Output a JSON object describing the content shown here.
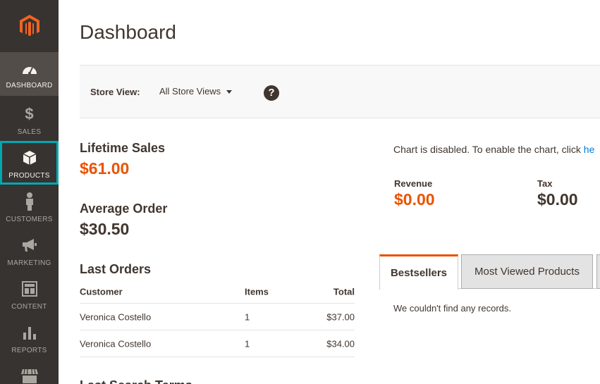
{
  "sidebar": {
    "logo": "magento-logo",
    "items": [
      {
        "label": "DASHBOARD",
        "icon": "gauge-icon",
        "state": "active"
      },
      {
        "label": "SALES",
        "icon": "dollar-icon",
        "state": "normal"
      },
      {
        "label": "PRODUCTS",
        "icon": "box-icon",
        "state": "focused"
      },
      {
        "label": "CUSTOMERS",
        "icon": "person-icon",
        "state": "normal"
      },
      {
        "label": "MARKETING",
        "icon": "megaphone-icon",
        "state": "normal"
      },
      {
        "label": "CONTENT",
        "icon": "layout-icon",
        "state": "normal"
      },
      {
        "label": "REPORTS",
        "icon": "bar-chart-icon",
        "state": "normal"
      },
      {
        "label": "",
        "icon": "store-icon",
        "state": "normal"
      }
    ]
  },
  "header": {
    "title": "Dashboard"
  },
  "store_switcher": {
    "label": "Store View:",
    "value": "All Store Views",
    "help": "?"
  },
  "lifetime_sales": {
    "title": "Lifetime Sales",
    "value": "$61.00"
  },
  "average_order": {
    "title": "Average Order",
    "value": "$30.50"
  },
  "last_orders": {
    "title": "Last Orders",
    "columns": [
      "Customer",
      "Items",
      "Total"
    ],
    "rows": [
      [
        "Veronica Costello",
        "1",
        "$37.00"
      ],
      [
        "Veronica Costello",
        "1",
        "$34.00"
      ]
    ]
  },
  "next_section": {
    "title": "Last Search Terms"
  },
  "chart": {
    "message": "Chart is disabled. To enable the chart, click ",
    "link": "he"
  },
  "totals": {
    "revenue": {
      "label": "Revenue",
      "value": "$0.00"
    },
    "tax": {
      "label": "Tax",
      "value": "$0.00"
    }
  },
  "tabs": {
    "items": [
      "Bestsellers",
      "Most Viewed Products"
    ],
    "empty_message": "We couldn't find any records."
  },
  "colors": {
    "accent": "#eb5202",
    "sidebar": "#373330",
    "focus": "#00a8b2",
    "link": "#007bdb"
  }
}
